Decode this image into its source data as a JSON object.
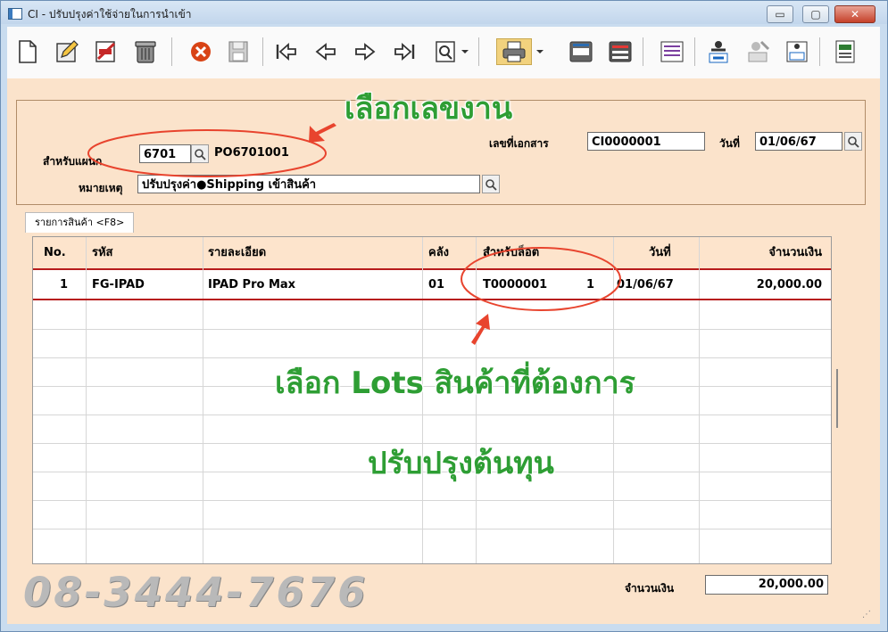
{
  "window": {
    "title": "CI - ปรับปรุงค่าใช้จ่ายในการนำเข้า",
    "min_glyph": "▭",
    "max_glyph": "▢",
    "close_glyph": "✕"
  },
  "toolbar": {
    "buttons": [
      "new-document",
      "edit",
      "void",
      "delete",
      "cancel",
      "save",
      "first-record",
      "previous-record",
      "next-record",
      "last-record",
      "find",
      "print",
      "note",
      "report",
      "relink",
      "approve",
      "unapprove",
      "approve-all",
      "export"
    ]
  },
  "header": {
    "dept_label": "สำหรับแผนก",
    "dept_code": "6701",
    "po_number": "PO6701001",
    "doc_no_label": "เลขที่เอกสาร",
    "doc_no": "CI0000001",
    "date_label": "วันที่",
    "date": "01/06/67",
    "remark_label": "หมายเหตุ",
    "remark": "ปรับปรุงค่า●Shipping เข้าสินค้า"
  },
  "tab": {
    "label": "รายการสินค้า <F8>"
  },
  "grid": {
    "columns": [
      "No.",
      "รหัส",
      "รายละเอียด",
      "คลัง",
      "สำหรับล็อต",
      "วันที่",
      "จำนวนเงิน"
    ],
    "rows": [
      {
        "no": "1",
        "code": "FG-IPAD",
        "desc": "IPAD Pro Max",
        "wh": "01",
        "lot": "T0000001",
        "lot_seq": "1",
        "date": "01/06/67",
        "amount": "20,000.00"
      }
    ]
  },
  "footer": {
    "total_label": "จำนวนเงิน",
    "total": "20,000.00"
  },
  "annotations": {
    "select_job": "เลือกเลขงาน",
    "select_lots": "เลือก Lots สินค้าที่ต้องการ",
    "adjust_cost": "ปรับปรุงต้นทุน",
    "phone": "08-3444-7676",
    "color": "#2e9e34",
    "arrow_color": "#e8442e"
  },
  "colors": {
    "form_bg": "#fbe3cb",
    "header_bg": "#fde4cc",
    "row_line": "#b71c1c",
    "title_bar": "#c9dcef"
  }
}
